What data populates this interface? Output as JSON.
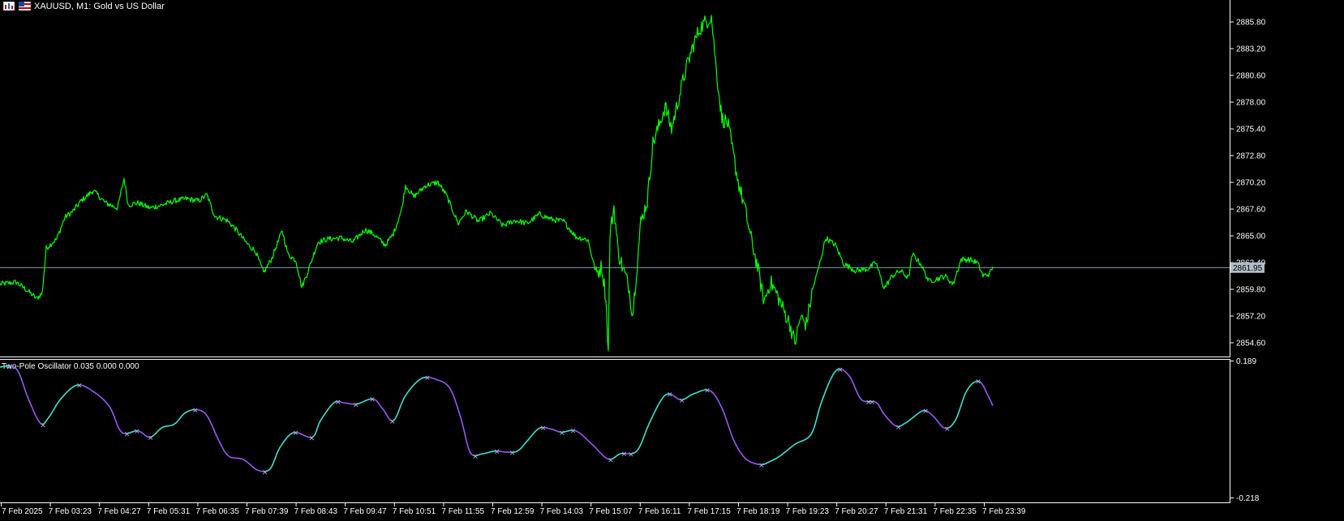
{
  "window": {
    "title": "XAUUSD, M1:  Gold vs US Dollar",
    "icons": [
      "bar-chart-icon",
      "symbol-flag-icon"
    ]
  },
  "colors": {
    "background": "#000000",
    "price_line": "#00ff00",
    "axis": "#ffffff",
    "current_price_line": "#8fa3b8",
    "price_tag_bg": "#b0bcc8",
    "osc_bull": "#40e0d0",
    "osc_bear": "#9a58f0"
  },
  "chart_data": [
    {
      "type": "line",
      "series": [
        {
          "name": "",
          "values": []
        }
      ],
      "price_points": [
        [
          0,
          2860.3
        ],
        [
          20,
          2860.5
        ],
        [
          35,
          2859.6
        ],
        [
          45,
          2858.9
        ],
        [
          52,
          2859.4
        ],
        [
          57,
          2863.8
        ],
        [
          70,
          2864.7
        ],
        [
          80,
          2866.8
        ],
        [
          90,
          2867.4
        ],
        [
          100,
          2868.4
        ],
        [
          115,
          2869.4
        ],
        [
          130,
          2868.2
        ],
        [
          145,
          2867.7
        ],
        [
          153,
          2870.6
        ],
        [
          158,
          2868.0
        ],
        [
          170,
          2868.2
        ],
        [
          185,
          2867.7
        ],
        [
          200,
          2868.0
        ],
        [
          215,
          2868.4
        ],
        [
          230,
          2868.6
        ],
        [
          245,
          2868.4
        ],
        [
          255,
          2869.0
        ],
        [
          265,
          2866.9
        ],
        [
          280,
          2866.5
        ],
        [
          290,
          2865.7
        ],
        [
          305,
          2864.2
        ],
        [
          315,
          2863.5
        ],
        [
          325,
          2861.4
        ],
        [
          335,
          2862.8
        ],
        [
          348,
          2865.5
        ],
        [
          355,
          2863.2
        ],
        [
          365,
          2862.6
        ],
        [
          372,
          2860.0
        ],
        [
          380,
          2861.6
        ],
        [
          392,
          2864.4
        ],
        [
          405,
          2864.7
        ],
        [
          420,
          2864.8
        ],
        [
          435,
          2864.4
        ],
        [
          450,
          2865.6
        ],
        [
          460,
          2865.2
        ],
        [
          475,
          2864.1
        ],
        [
          485,
          2865.2
        ],
        [
          495,
          2867.5
        ],
        [
          500,
          2869.9
        ],
        [
          510,
          2868.8
        ],
        [
          525,
          2869.9
        ],
        [
          540,
          2870.2
        ],
        [
          550,
          2869.0
        ],
        [
          565,
          2866.2
        ],
        [
          575,
          2867.4
        ],
        [
          590,
          2866.4
        ],
        [
          605,
          2867.2
        ],
        [
          620,
          2866.0
        ],
        [
          635,
          2866.5
        ],
        [
          650,
          2866.2
        ],
        [
          665,
          2867.1
        ],
        [
          680,
          2866.6
        ],
        [
          695,
          2866.4
        ],
        [
          710,
          2864.9
        ],
        [
          725,
          2864.6
        ],
        [
          735,
          2861.3
        ],
        [
          742,
          2862.0
        ],
        [
          747,
          2859.0
        ],
        [
          750,
          2853.7
        ],
        [
          752,
          2865.2
        ],
        [
          757,
          2867.8
        ],
        [
          762,
          2863.5
        ],
        [
          768,
          2861.8
        ],
        [
          775,
          2860.2
        ],
        [
          780,
          2857.3
        ],
        [
          790,
          2866.3
        ],
        [
          798,
          2868.4
        ],
        [
          805,
          2874.0
        ],
        [
          812,
          2875.6
        ],
        [
          820,
          2877.6
        ],
        [
          828,
          2875.4
        ],
        [
          836,
          2878.1
        ],
        [
          845,
          2881.0
        ],
        [
          855,
          2883.6
        ],
        [
          863,
          2885.2
        ],
        [
          870,
          2885.8
        ],
        [
          877,
          2886.4
        ],
        [
          883,
          2881.3
        ],
        [
          890,
          2876.4
        ],
        [
          897,
          2876.0
        ],
        [
          903,
          2873.4
        ],
        [
          910,
          2870.3
        ],
        [
          918,
          2867.8
        ],
        [
          926,
          2864.7
        ],
        [
          934,
          2862.0
        ],
        [
          942,
          2858.6
        ],
        [
          950,
          2860.5
        ],
        [
          958,
          2859.3
        ],
        [
          966,
          2857.8
        ],
        [
          974,
          2856.4
        ],
        [
          980,
          2854.5
        ],
        [
          987,
          2857.1
        ],
        [
          994,
          2856.4
        ],
        [
          1002,
          2859.8
        ],
        [
          1010,
          2862.1
        ],
        [
          1018,
          2864.8
        ],
        [
          1030,
          2864.1
        ],
        [
          1040,
          2862.3
        ],
        [
          1055,
          2861.6
        ],
        [
          1070,
          2861.8
        ],
        [
          1080,
          2862.4
        ],
        [
          1090,
          2859.9
        ],
        [
          1100,
          2861.1
        ],
        [
          1110,
          2861.6
        ],
        [
          1120,
          2860.9
        ],
        [
          1125,
          2863.2
        ],
        [
          1135,
          2862.3
        ],
        [
          1145,
          2860.6
        ],
        [
          1155,
          2860.8
        ],
        [
          1165,
          2861.1
        ],
        [
          1175,
          2860.3
        ],
        [
          1185,
          2862.7
        ],
        [
          1195,
          2862.7
        ],
        [
          1205,
          2862.4
        ],
        [
          1212,
          2861.1
        ],
        [
          1220,
          2861.3
        ],
        [
          1224,
          2862.0
        ]
      ]
    },
    {
      "type": "line",
      "series": [
        {
          "name": "",
          "values": []
        }
      ],
      "osc_points": [
        [
          0,
          0.17
        ],
        [
          20,
          0.165
        ],
        [
          35,
          0.075
        ],
        [
          50,
          0.002
        ],
        [
          60,
          0.02
        ],
        [
          75,
          0.075
        ],
        [
          95,
          0.116
        ],
        [
          115,
          0.097
        ],
        [
          135,
          0.052
        ],
        [
          150,
          -0.024
        ],
        [
          170,
          -0.02
        ],
        [
          185,
          -0.039
        ],
        [
          200,
          -0.01
        ],
        [
          215,
          -0.0
        ],
        [
          228,
          0.033
        ],
        [
          242,
          0.043
        ],
        [
          255,
          0.026
        ],
        [
          270,
          -0.05
        ],
        [
          282,
          -0.095
        ],
        [
          300,
          -0.105
        ],
        [
          318,
          -0.137
        ],
        [
          333,
          -0.133
        ],
        [
          345,
          -0.07
        ],
        [
          362,
          -0.025
        ],
        [
          385,
          -0.039
        ],
        [
          395,
          0.01
        ],
        [
          412,
          0.064
        ],
        [
          425,
          0.063
        ],
        [
          440,
          0.06
        ],
        [
          460,
          0.075
        ],
        [
          472,
          0.045
        ],
        [
          485,
          0.01
        ],
        [
          500,
          0.085
        ],
        [
          520,
          0.136
        ],
        [
          540,
          0.131
        ],
        [
          555,
          0.105
        ],
        [
          568,
          0.02
        ],
        [
          580,
          -0.085
        ],
        [
          595,
          -0.088
        ],
        [
          610,
          -0.08
        ],
        [
          625,
          -0.083
        ],
        [
          638,
          -0.08
        ],
        [
          650,
          -0.05
        ],
        [
          665,
          -0.012
        ],
        [
          680,
          -0.015
        ],
        [
          692,
          -0.024
        ],
        [
          710,
          -0.02
        ],
        [
          730,
          -0.06
        ],
        [
          750,
          -0.104
        ],
        [
          765,
          -0.088
        ],
        [
          785,
          -0.08
        ],
        [
          800,
          0.0
        ],
        [
          815,
          0.071
        ],
        [
          825,
          0.09
        ],
        [
          840,
          0.072
        ],
        [
          855,
          0.09
        ],
        [
          875,
          0.1
        ],
        [
          890,
          0.048
        ],
        [
          905,
          -0.05
        ],
        [
          920,
          -0.104
        ],
        [
          938,
          -0.12
        ],
        [
          950,
          -0.11
        ],
        [
          962,
          -0.094
        ],
        [
          980,
          -0.06
        ],
        [
          1000,
          -0.03
        ],
        [
          1012,
          0.06
        ],
        [
          1025,
          0.138
        ],
        [
          1035,
          0.164
        ],
        [
          1048,
          0.14
        ],
        [
          1062,
          0.073
        ],
        [
          1080,
          0.065
        ],
        [
          1090,
          0.03
        ],
        [
          1105,
          -0.006
        ],
        [
          1118,
          0.006
        ],
        [
          1138,
          0.04
        ],
        [
          1150,
          0.025
        ],
        [
          1165,
          -0.012
        ],
        [
          1178,
          0.012
        ],
        [
          1192,
          0.1
        ],
        [
          1207,
          0.128
        ],
        [
          1218,
          0.085
        ],
        [
          1224,
          0.055
        ]
      ]
    }
  ],
  "price_axis": {
    "ticks": [
      "2885.80",
      "2883.20",
      "2880.60",
      "2878.00",
      "2875.40",
      "2872.80",
      "2870.20",
      "2867.60",
      "2865.00",
      "2862.40",
      "2859.80",
      "2857.20",
      "2854.60"
    ],
    "tick_values": [
      2885.8,
      2883.2,
      2880.6,
      2878.0,
      2875.4,
      2872.8,
      2870.2,
      2867.6,
      2865.0,
      2862.4,
      2859.8,
      2857.2,
      2854.6
    ],
    "ylim": [
      2853.5,
      2887.3
    ],
    "current_price": 2861.95,
    "current_price_label": "2861.95"
  },
  "indicator": {
    "label": "Two-Pole Oscillator 0.035 0.000 0.000",
    "max_label": "0.189",
    "min_label": "-0.218",
    "ylim": [
      -0.218,
      0.189
    ]
  },
  "time_axis": {
    "labels": [
      "7 Feb 2025",
      "7 Feb 03:23",
      "7 Feb 04:27",
      "7 Feb 05:31",
      "7 Feb 06:35",
      "7 Feb 07:39",
      "7 Feb 08:43",
      "7 Feb 09:47",
      "7 Feb 10:51",
      "7 Feb 11:55",
      "7 Feb 12:59",
      "7 Feb 14:03",
      "7 Feb 15:07",
      "7 Feb 16:11",
      "7 Feb 17:15",
      "7 Feb 18:19",
      "7 Feb 19:23",
      "7 Feb 20:27",
      "7 Feb 21:31",
      "7 Feb 22:35",
      "7 Feb 23:39"
    ]
  }
}
